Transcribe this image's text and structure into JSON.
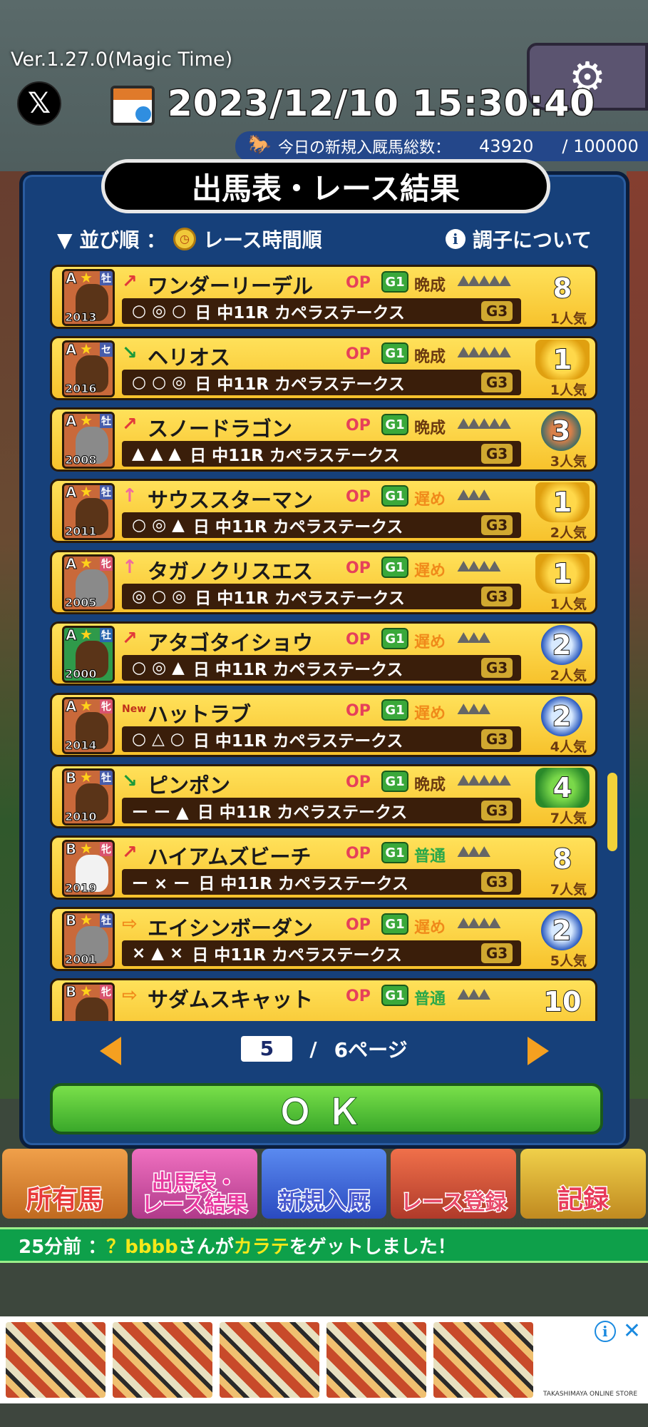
{
  "header": {
    "version": "Ver.1.27.0(Magic Time)",
    "x_label": "𝕏",
    "datetime": "2023/12/10 15:30:40",
    "horse_count_label": "今日の新規入厩馬総数：",
    "horse_count": "43920",
    "horse_count_max": "/ 100000"
  },
  "panel": {
    "title": "出馬表・レース結果",
    "sort_label": "▼ 並び順 ：",
    "sort_value": "レース時間順",
    "condition_link": "調子について"
  },
  "horses": [
    {
      "grade": "A",
      "sex": "牡",
      "year": "2013",
      "trend": "↗",
      "trend_class": "",
      "name": "ワンダーリーデル",
      "op": "OP",
      "g1": "G1",
      "style": "晩成",
      "style_class": "late",
      "shoes": "⛰⛰⛰⛰⛰",
      "marks": "○ ◎ ○",
      "info": "日 中11R カペラステークス",
      "g3": "G3",
      "result": "8",
      "result_class": "",
      "popularity": "1人気",
      "portrait": ""
    },
    {
      "grade": "A",
      "sex": "セ",
      "year": "2016",
      "trend": "↘",
      "trend_class": "down",
      "name": "ヘリオス",
      "op": "OP",
      "g1": "G1",
      "style": "晩成",
      "style_class": "late",
      "shoes": "⛰⛰⛰⛰⛰",
      "marks": "○ ○ ◎",
      "info": "日 中11R カペラステークス",
      "g3": "G3",
      "result": "1",
      "result_class": "gold",
      "popularity": "1人気",
      "portrait": ""
    },
    {
      "grade": "A",
      "sex": "牡",
      "year": "2008",
      "trend": "↗",
      "trend_class": "",
      "name": "スノードラゴン",
      "op": "OP",
      "g1": "G1",
      "style": "晩成",
      "style_class": "late",
      "shoes": "⛰⛰⛰⛰⛰",
      "marks": "▲ ▲ ▲",
      "info": "日 中11R カペラステークス",
      "g3": "G3",
      "result": "3",
      "result_class": "bronze",
      "popularity": "3人気",
      "portrait": "grey"
    },
    {
      "grade": "A",
      "sex": "牡",
      "year": "2011",
      "trend": "↑",
      "trend_class": "up",
      "name": "サウススターマン",
      "op": "OP",
      "g1": "G1",
      "style": "遅め",
      "style_class": "slow",
      "shoes": "⛰⛰⛰",
      "marks": "○ ◎ ▲",
      "info": "日 中11R カペラステークス",
      "g3": "G3",
      "result": "1",
      "result_class": "gold",
      "popularity": "2人気",
      "portrait": ""
    },
    {
      "grade": "A",
      "sex": "牝",
      "year": "2005",
      "trend": "↑",
      "trend_class": "up",
      "name": "タガノクリスエス",
      "op": "OP",
      "g1": "G1",
      "style": "遅め",
      "style_class": "slow",
      "shoes": "⛰⛰⛰⛰",
      "marks": "◎ ○ ◎",
      "info": "日 中11R カペラステークス",
      "g3": "G3",
      "result": "1",
      "result_class": "gold",
      "popularity": "1人気",
      "portrait": "grey"
    },
    {
      "grade": "A",
      "sex": "牡",
      "year": "2000",
      "trend": "↗",
      "trend_class": "",
      "name": "アタゴタイショウ",
      "op": "OP",
      "g1": "G1",
      "style": "遅め",
      "style_class": "slow",
      "shoes": "⛰⛰⛰",
      "marks": "○ ◎ ▲",
      "info": "日 中11R カペラステークス",
      "g3": "G3",
      "result": "2",
      "result_class": "silver",
      "popularity": "2人気",
      "portrait": "green"
    },
    {
      "grade": "A",
      "sex": "牝",
      "year": "2014",
      "trend": "New",
      "trend_class": "new",
      "name": "ハットラブ",
      "op": "OP",
      "g1": "G1",
      "style": "遅め",
      "style_class": "slow",
      "shoes": "⛰⛰⛰",
      "marks": "○ △ ○",
      "info": "日 中11R カペラステークス",
      "g3": "G3",
      "result": "2",
      "result_class": "silver",
      "popularity": "4人気",
      "portrait": ""
    },
    {
      "grade": "B",
      "sex": "牡",
      "year": "2010",
      "trend": "↘",
      "trend_class": "down",
      "name": "ピンポン",
      "op": "OP",
      "g1": "G1",
      "style": "晩成",
      "style_class": "late",
      "shoes": "⛰⛰⛰⛰⛰",
      "marks": "ー ー ▲",
      "info": "日 中11R カペラステークス",
      "g3": "G3",
      "result": "4",
      "result_class": "green",
      "popularity": "7人気",
      "portrait": ""
    },
    {
      "grade": "B",
      "sex": "牝",
      "year": "2019",
      "trend": "↗",
      "trend_class": "",
      "name": "ハイアムズビーチ",
      "op": "OP",
      "g1": "G1",
      "style": "普通",
      "style_class": "normal",
      "shoes": "⛰⛰⛰",
      "marks": "ー × ー",
      "info": "日 中11R カペラステークス",
      "g3": "G3",
      "result": "8",
      "result_class": "",
      "popularity": "7人気",
      "portrait": "white"
    },
    {
      "grade": "B",
      "sex": "牡",
      "year": "2001",
      "trend": "⇨",
      "trend_class": "flat",
      "name": "エイシンボーダン",
      "op": "OP",
      "g1": "G1",
      "style": "遅め",
      "style_class": "slow",
      "shoes": "⛰⛰⛰⛰",
      "marks": "× ▲ ×",
      "info": "日 中11R カペラステークス",
      "g3": "G3",
      "result": "2",
      "result_class": "silver",
      "popularity": "5人気",
      "portrait": "grey"
    },
    {
      "grade": "B",
      "sex": "牝",
      "year": "",
      "trend": "⇨",
      "trend_class": "flat",
      "name": "サダムスキャット",
      "op": "OP",
      "g1": "G1",
      "style": "普通",
      "style_class": "normal",
      "shoes": "⛰⛰⛰",
      "marks": "",
      "info": "",
      "g3": "",
      "result": "10",
      "result_class": "",
      "popularity": "",
      "portrait": ""
    }
  ],
  "pager": {
    "current": "5",
    "sep": "/",
    "total": "6ページ"
  },
  "ok_label": "ＯＫ",
  "bottom_nav": [
    "所有馬",
    "出馬表・\nレース結果",
    "新規入厩",
    "レース登録",
    "記録"
  ],
  "ticker": {
    "prefix": "25分前 ： ",
    "user": "？bbbb",
    "mid": "さんが",
    "item": "カラテ",
    "suffix": "をゲットしました！"
  },
  "ad": {
    "brand": "TAKASHIMAYA ONLINE STORE"
  }
}
